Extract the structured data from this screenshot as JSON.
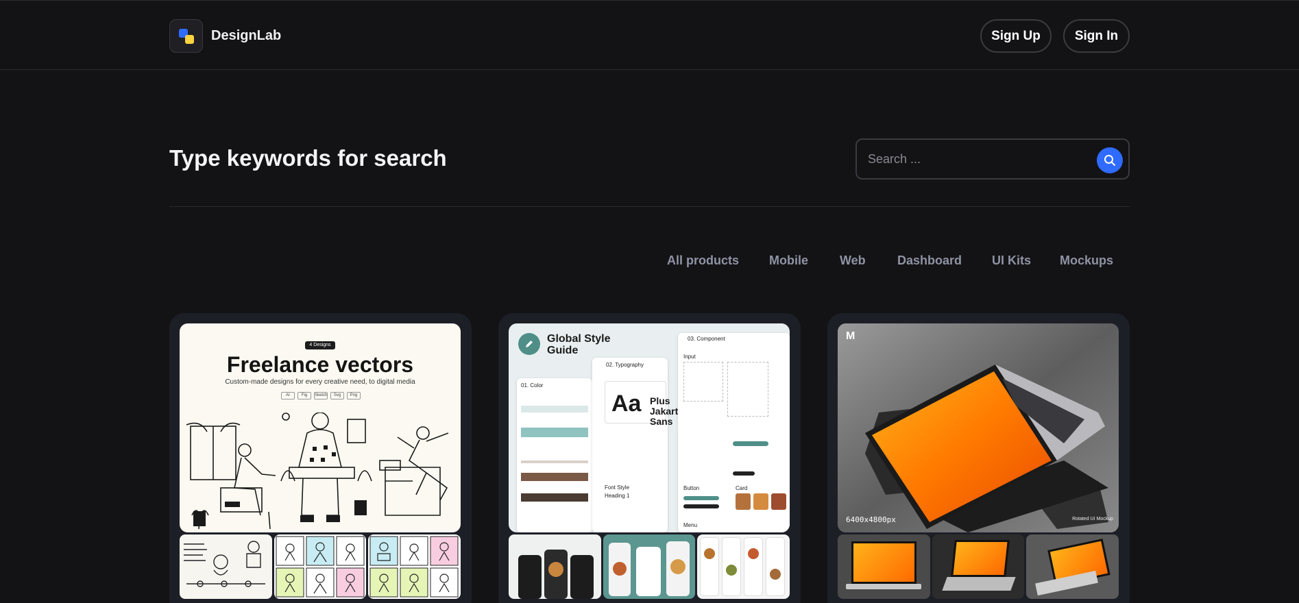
{
  "header": {
    "brand": "DesignLab",
    "signup_label": "Sign Up",
    "signin_label": "Sign In"
  },
  "search": {
    "heading": "Type keywords for search",
    "placeholder": "Search ..."
  },
  "filters": [
    "All products",
    "Mobile",
    "Web",
    "Dashboard",
    "UI Kits",
    "Mockups"
  ],
  "cards": [
    {
      "title": "Freelance vectors",
      "tag": "4 Designs",
      "subtitle": "Custom-made designs for every creative need, to digital media",
      "chips": [
        "AI",
        "Fig",
        "Sketch",
        "Svg",
        "Png"
      ]
    },
    {
      "title": "Global Style Guide",
      "labels": [
        "01. Color",
        "02. Typography",
        "03. Component",
        "Input",
        "Button",
        "Card",
        "Font Style",
        "Heading 1",
        "Menu"
      ],
      "aa": "Aa",
      "font_name": "Plus Jakarta Sans"
    },
    {
      "mark": "M",
      "size_label": "6400x4800px",
      "caption": "Rotated UI Mockup"
    }
  ],
  "colors": {
    "background": "#131316",
    "card": "#1d1f27",
    "accent": "#2f6bff",
    "logo_yellow": "#ffd23f",
    "filter_text": "#8f93a3"
  }
}
